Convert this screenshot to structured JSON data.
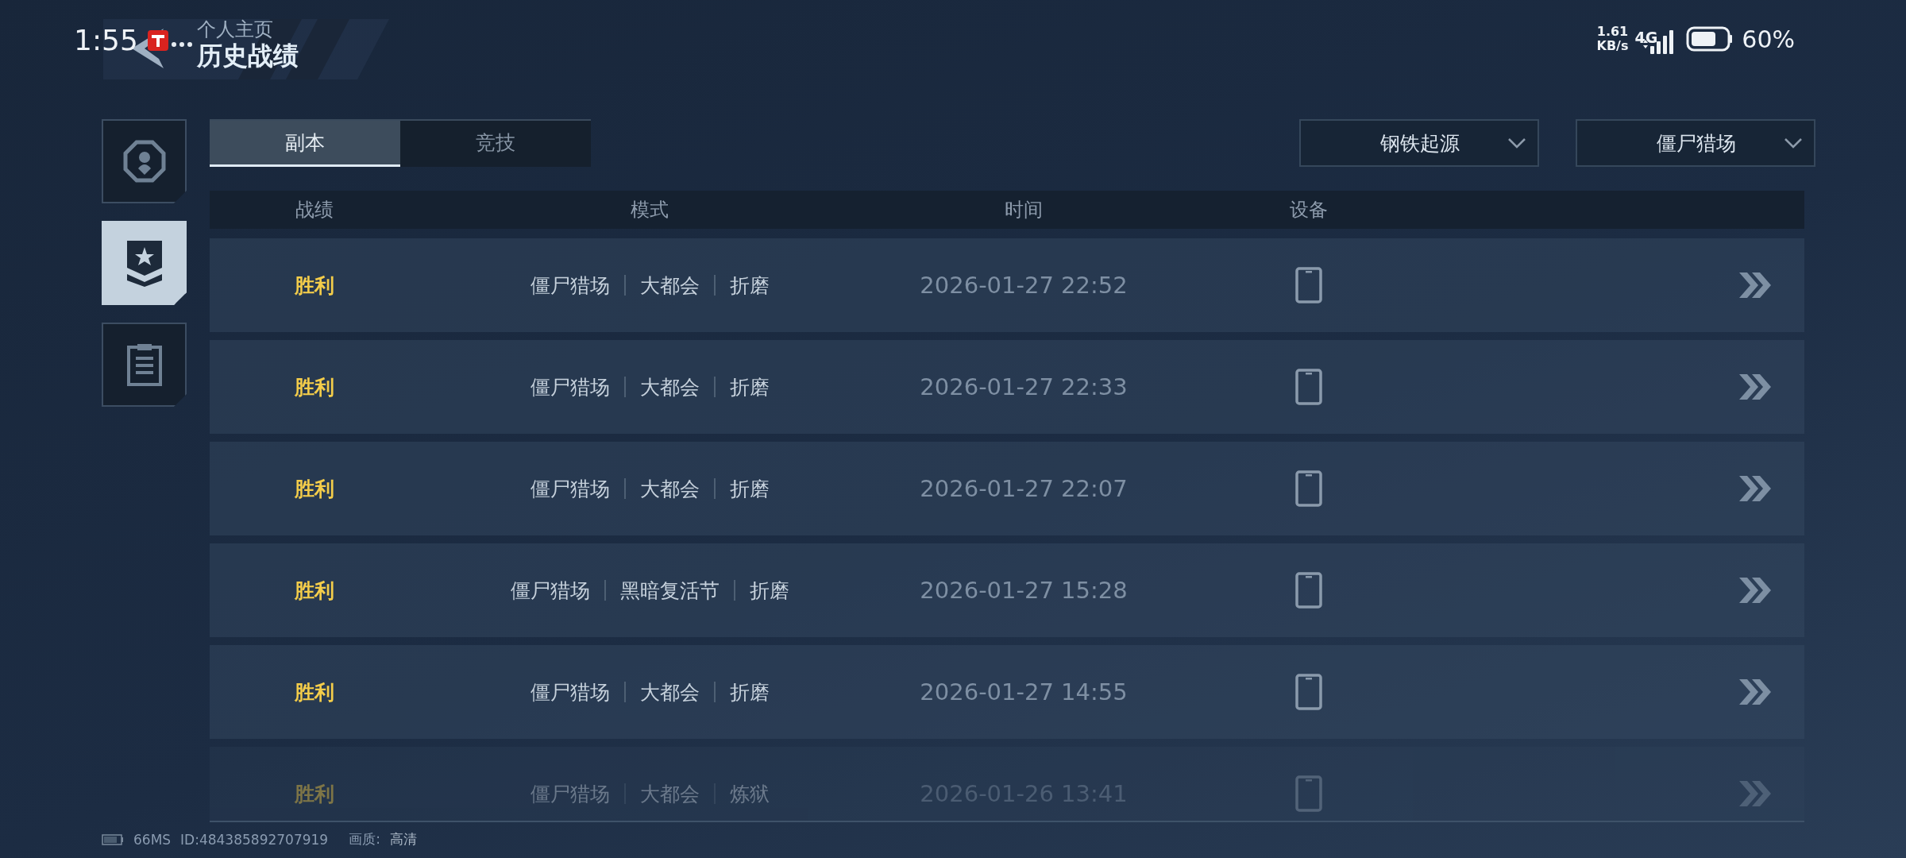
{
  "status_bar": {
    "time": "1:55",
    "net_speed": "1.61",
    "net_unit": "KB/s",
    "network": "4G",
    "battery": "60%"
  },
  "header": {
    "parent": "个人主页",
    "title": "历史战绩"
  },
  "sidebar": {
    "items": [
      {
        "kind": "profile",
        "selected": false
      },
      {
        "kind": "medal",
        "selected": true
      },
      {
        "kind": "clipboard",
        "selected": false
      }
    ]
  },
  "tabs": [
    {
      "label": "副本",
      "selected": true
    },
    {
      "label": "竞技",
      "selected": false
    }
  ],
  "filters": [
    {
      "value": "钢铁起源"
    },
    {
      "value": "僵尸猎场"
    }
  ],
  "table": {
    "columns": [
      "战绩",
      "模式",
      "时间",
      "设备"
    ],
    "rows": [
      {
        "result": "胜利",
        "mode": [
          "僵尸猎场",
          "大都会",
          "折磨"
        ],
        "time": "2026-01-27 22:52",
        "faded": false
      },
      {
        "result": "胜利",
        "mode": [
          "僵尸猎场",
          "大都会",
          "折磨"
        ],
        "time": "2026-01-27 22:33",
        "faded": false
      },
      {
        "result": "胜利",
        "mode": [
          "僵尸猎场",
          "大都会",
          "折磨"
        ],
        "time": "2026-01-27 22:07",
        "faded": false
      },
      {
        "result": "胜利",
        "mode": [
          "僵尸猎场",
          "黑暗复活节",
          "折磨"
        ],
        "time": "2026-01-27 15:28",
        "faded": false
      },
      {
        "result": "胜利",
        "mode": [
          "僵尸猎场",
          "大都会",
          "折磨"
        ],
        "time": "2026-01-27 14:55",
        "faded": false
      },
      {
        "result": "胜利",
        "mode": [
          "僵尸猎场",
          "大都会",
          "炼狱"
        ],
        "time": "2026-01-26 13:41",
        "faded": true
      }
    ]
  },
  "footer": {
    "ping": "66MS",
    "id": "ID:484385892707919",
    "quality_label": "画质:",
    "quality": "高清"
  }
}
